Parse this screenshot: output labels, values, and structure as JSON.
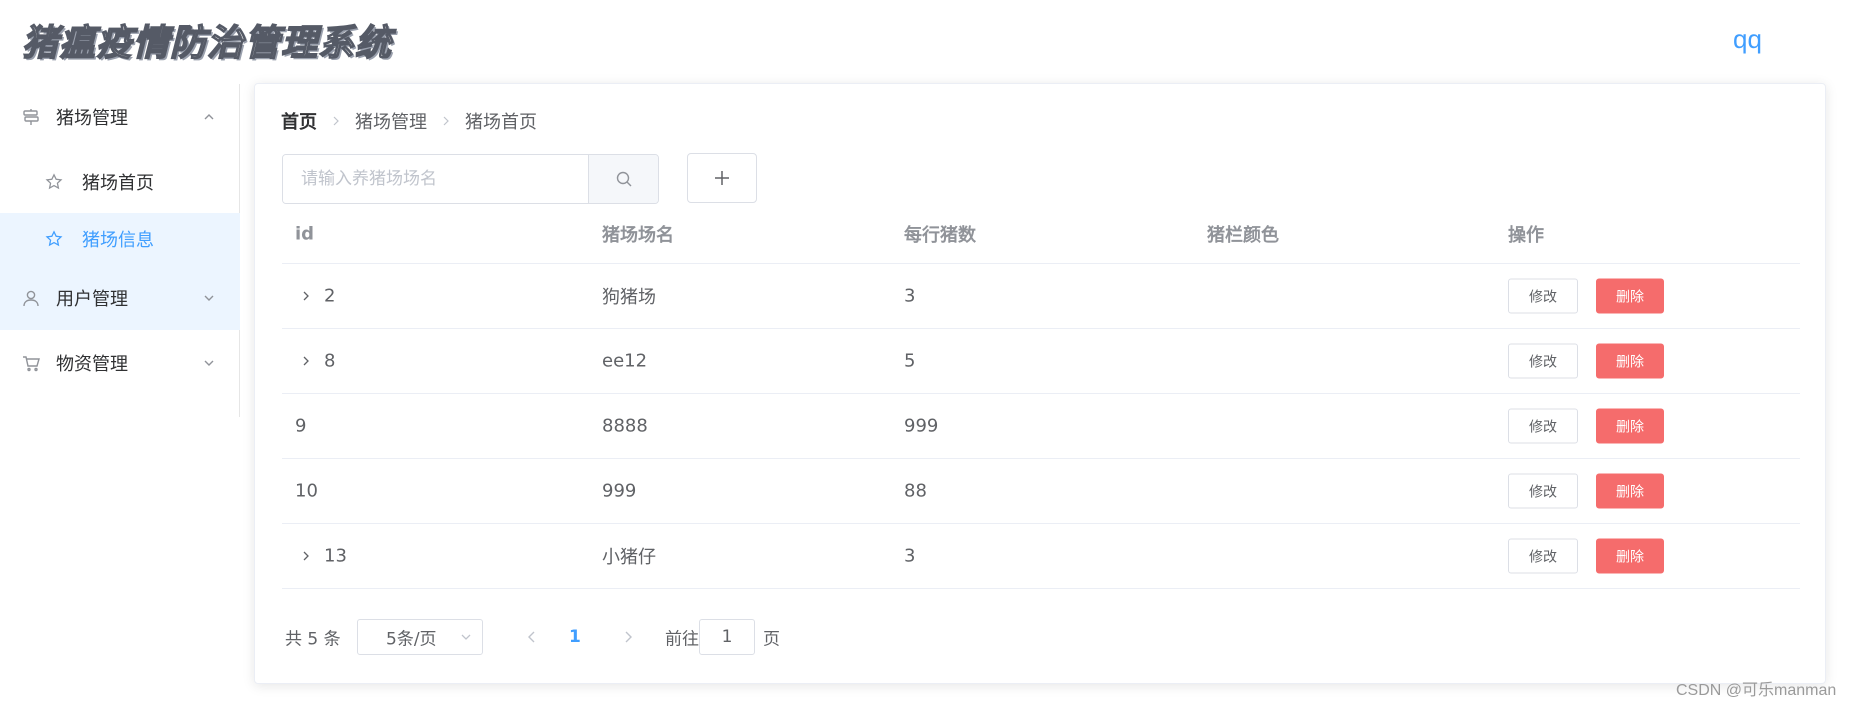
{
  "header": {
    "title": "猪瘟疫情防治管理系统",
    "user": "qq"
  },
  "sidebar": {
    "groups": [
      {
        "label": "猪场管理",
        "icon": "signpost-icon",
        "expanded": true,
        "items": [
          {
            "label": "猪场首页",
            "icon": "star-icon"
          },
          {
            "label": "猪场信息",
            "icon": "star-icon",
            "active": true
          }
        ]
      },
      {
        "label": "用户管理",
        "icon": "user-icon",
        "expanded": false
      },
      {
        "label": "物资管理",
        "icon": "cart-icon",
        "expanded": false
      }
    ]
  },
  "breadcrumb": [
    "首页",
    "猪场管理",
    "猪场首页"
  ],
  "search": {
    "placeholder": "请输入养猪场场名",
    "value": ""
  },
  "table": {
    "headers": [
      "id",
      "猪场场名",
      "每行猪数",
      "猪栏颜色",
      "操作"
    ],
    "rows": [
      {
        "id": "2",
        "name": "狗猪场",
        "count": "3",
        "color": "",
        "expandable": true
      },
      {
        "id": "8",
        "name": "ee12",
        "count": "5",
        "color": "",
        "expandable": true
      },
      {
        "id": "9",
        "name": "8888",
        "count": "999",
        "color": "",
        "expandable": false
      },
      {
        "id": "10",
        "name": "999",
        "count": "88",
        "color": "",
        "expandable": false
      },
      {
        "id": "13",
        "name": "小猪仔",
        "count": "3",
        "color": "",
        "expandable": true
      }
    ],
    "edit_label": "修改",
    "delete_label": "删除"
  },
  "pagination": {
    "total": "共 5 条",
    "page_size": "5条/页",
    "current": "1",
    "goto_label": "前往",
    "goto_value": "1",
    "goto_unit": "页"
  },
  "watermark": "CSDN @可乐manman",
  "colors": {
    "accent": "#409eff",
    "danger": "#f56c6c",
    "active_bg": "#ecf5ff"
  }
}
